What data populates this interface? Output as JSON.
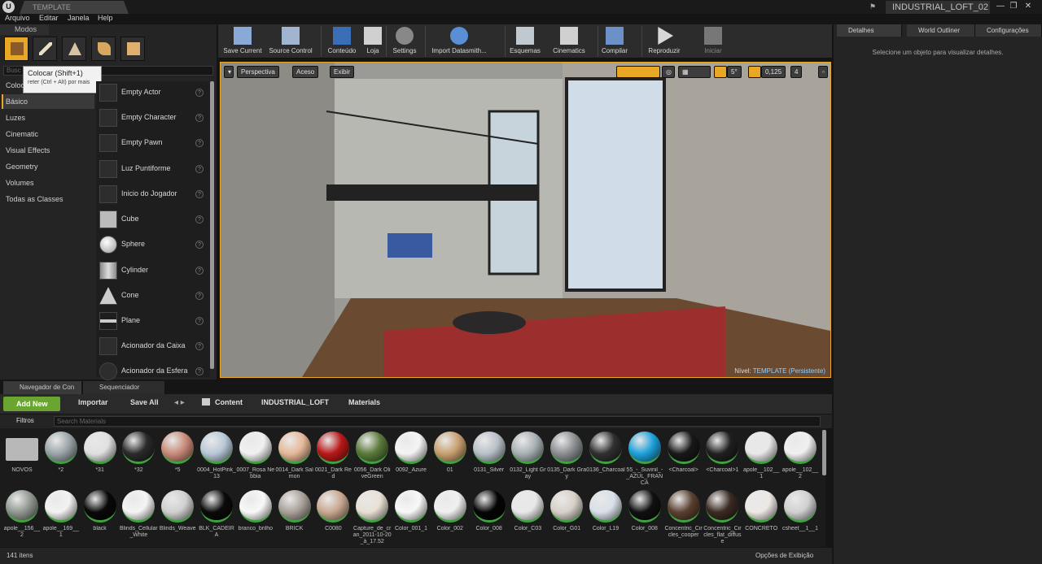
{
  "title_bar": {
    "tab_label": "TEMPLATE",
    "project": "INDUSTRIAL_LOFT_02",
    "logo_text": "U"
  },
  "menu": [
    "Arquivo",
    "Editar",
    "Janela",
    "Help"
  ],
  "modes": {
    "tab": "Modos",
    "tooltip_title": "Colocar (Shift+1)",
    "tooltip_sub": "reter (Ctrl + Alt) por mais",
    "search_placeholder": "Busc"
  },
  "categories": [
    "Coloc",
    "Básico",
    "Luzes",
    "Cinematic",
    "Visual Effects",
    "Geometry",
    "Volumes",
    "Todas as Classes"
  ],
  "actors": [
    "Empty Actor",
    "Empty Character",
    "Empty Pawn",
    "Luz Puntiforme",
    "Inicio do Jogador",
    "Cube",
    "Sphere",
    "Cylinder",
    "Cone",
    "Plane",
    "Acionador da Caixa",
    "Acionador da Esfera"
  ],
  "toolbar": [
    "Save Current",
    "Source Control",
    "Conteúdo",
    "Loja",
    "Settings",
    "Import Datasmith...",
    "Esquemas",
    "Cinematics",
    "Compilar",
    "Reproduzir",
    "Iniciar"
  ],
  "viewport": {
    "perspective": "Perspectiva",
    "lit": "Aceso",
    "show": "Exibir",
    "fov": "5°",
    "speed": "0,125",
    "cam": "4",
    "level_prefix": "Nível:",
    "level_name": "TEMPLATE (Persistente)"
  },
  "right": {
    "tabs": [
      "Detalhes",
      "World Outliner",
      "Configurações"
    ],
    "message": "Selecione um objeto para visualizar detalhes."
  },
  "content_browser": {
    "tabs": [
      "Navegador de Con",
      "Sequenciador"
    ],
    "add_new": "Add New",
    "import": "Importar",
    "save_all": "Save All",
    "path": [
      "Content",
      "INDUSTRIAL_LOFT",
      "Materials"
    ],
    "filters": "Filtros",
    "search_placeholder": "Search Materials",
    "item_count": "141 itens",
    "view_options": "Opções de Exibição"
  },
  "assets_row1": [
    "NOVOS",
    "*2",
    "*31",
    "*32",
    "*5",
    "0004_HotPink_13",
    "0007_Rosa Nebbia",
    "0014_Dark Salmon",
    "0021_Dark Red",
    "0056_Dark OliveGreen",
    "0092_Azure",
    "01",
    "0131_Silver",
    "0132_Light Gray",
    "0135_Dark Gray",
    "0136_Charcoal",
    "55_-_Suvinil_-_AZUL_FRANCA",
    "<Charcoal>",
    "<Charcoal>1",
    "apole__102__1",
    "apole__102__2"
  ],
  "assets_row2": [
    "apole__156__2",
    "apole__169__1",
    "black",
    "Blinds_Cellular_White",
    "Blinds_Weave",
    "BLK_CADEIRA",
    "branco_brilho",
    "BRICK",
    "C0080",
    "Capture_de_cran_2011-10-20_à_17.52",
    "Color_001_1",
    "Color_002",
    "Color_008",
    "Color_C03",
    "Color_G01",
    "Color_L19",
    "Color_008",
    "Concentric_Circles_cooper",
    "Concentric_Circles_flat_diffuse",
    "CONCRETO",
    "csheet__1__1"
  ],
  "colors": {
    "accent": "#e8a825",
    "green": "#6aa532",
    "link": "#8fd0ff"
  }
}
